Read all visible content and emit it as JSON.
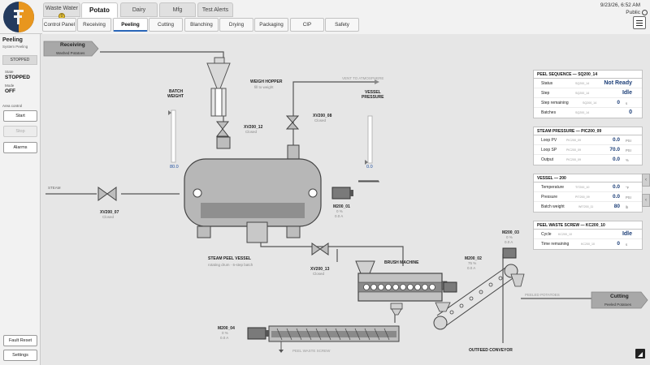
{
  "header": {
    "time": "9/23/26, 6:52 AM",
    "user": "Public",
    "tabs": [
      {
        "label": "Waste Water",
        "badge": "0"
      },
      {
        "label": "Potato"
      },
      {
        "label": "Dairy"
      },
      {
        "label": "Mfg"
      },
      {
        "label": "Test Alerts"
      }
    ]
  },
  "subnav": {
    "tabs": [
      "Control Panel",
      "Receiving",
      "Peeling",
      "Cutting",
      "Blanching",
      "Drying",
      "Packaging",
      "CIP",
      "Safety"
    ]
  },
  "sidebar": {
    "title": "Peeling",
    "subtitle": "System Peeling",
    "status_chip": "STOPPED",
    "state_label": "State",
    "state_value": "STOPPED",
    "mode_label": "Mode",
    "mode_value": "OFF",
    "area_control": "Area control",
    "start": "Start",
    "stop": "Stop",
    "alarms": "Alarms",
    "fault_reset": "Fault Reset",
    "settings": "Settings"
  },
  "diagram": {
    "receiving": {
      "title": "Receiving",
      "sub": "Washed Potatoes"
    },
    "cutting": {
      "title": "Cutting",
      "sub": "Peeled Potatoes"
    },
    "batch_weight": {
      "title1": "BATCH",
      "title2": "WEIGHT",
      "value": "80.0"
    },
    "vessel_pressure": {
      "title1": "VESSEL",
      "title2": "PRESSURE",
      "value": "0.0"
    },
    "weigh_hopper": {
      "title": "WEIGH HOPPER",
      "sub": "fill to weight"
    },
    "vent": "VENT TO ATMOSPHERE",
    "steam": "STEAM",
    "xv200_12": {
      "name": "XV200_12",
      "state": "Closed"
    },
    "xv200_08": {
      "name": "XV200_08",
      "state": "Closed"
    },
    "xv200_07": {
      "name": "XV200_07",
      "state": "Closed"
    },
    "xv200_13": {
      "name": "XV200_13",
      "state": "Closed"
    },
    "m200_01": {
      "name": "M200_01",
      "rpm": "0 %",
      "amps": "0.0 A"
    },
    "m200_02": {
      "name": "M200_02",
      "rpm": "75 %",
      "amps": "0.0 A"
    },
    "m200_03": {
      "name": "M200_03",
      "rpm": "0 %",
      "amps": "0.0 A"
    },
    "m200_04": {
      "name": "M200_04",
      "rpm": "0 %",
      "amps": "0.0 A"
    },
    "steam_peel_vessel": {
      "title": "STEAM PEEL VESSEL",
      "sub": "rotating drum · 6-step batch"
    },
    "brush_machine": "BRUSH MACHINE",
    "peeled_potatoes": "PEELED POTATOES",
    "peel_waste_screw": "PEEL WASTE SCREW",
    "outfeed_conveyor": "OUTFEED CONVEYOR"
  },
  "panels": {
    "peel_sequence": {
      "title": "PEEL SEQUENCE — SQ200_14",
      "rows": [
        {
          "label": "Status",
          "tag": "SQ200_14",
          "value": "Not Ready",
          "unit": ""
        },
        {
          "label": "Step",
          "tag": "SQ200_14",
          "value": "Idle",
          "unit": ""
        },
        {
          "label": "Step remaining",
          "tag": "SQ200_14",
          "value": "0",
          "unit": "s"
        },
        {
          "label": "Batches",
          "tag": "SQ200_14",
          "value": "0",
          "unit": ""
        }
      ]
    },
    "steam_pressure": {
      "title": "STEAM PRESSURE — PIC200_09",
      "rows": [
        {
          "label": "Loop PV",
          "tag": "PIC200_09",
          "value": "0.0",
          "unit": "PSI"
        },
        {
          "label": "Loop SP",
          "tag": "PIC200_09",
          "value": "70.0",
          "unit": "PSI"
        },
        {
          "label": "Output",
          "tag": "PIC200_09",
          "value": "0.0",
          "unit": "%"
        }
      ]
    },
    "vessel": {
      "title": "VESSEL — 200",
      "rows": [
        {
          "label": "Temperature",
          "tag": "TIT200_10",
          "value": "0.0",
          "unit": "°F"
        },
        {
          "label": "Pressure",
          "tag": "PIT200_09",
          "value": "0.0",
          "unit": "PSI"
        },
        {
          "label": "Batch weight",
          "tag": "WIT200_11",
          "value": "80",
          "unit": "lb"
        }
      ]
    },
    "peel_waste_screw": {
      "title": "PEEL WASTE SCREW — KC200_10",
      "rows": [
        {
          "label": "Cycle",
          "tag": "KC200_10",
          "value": "Idle",
          "unit": ""
        },
        {
          "label": "Time remaining",
          "tag": "KC200_10",
          "value": "0",
          "unit": "s"
        }
      ]
    }
  },
  "colors": {
    "accent": "#2a66b8",
    "value_blue": "#1d3f78",
    "equipment_fill": "#b8b8b8",
    "vessel_band": "#8f8f8f",
    "pipe": "#555555",
    "logo_navy": "#233a5e",
    "logo_orange": "#e8961e"
  }
}
